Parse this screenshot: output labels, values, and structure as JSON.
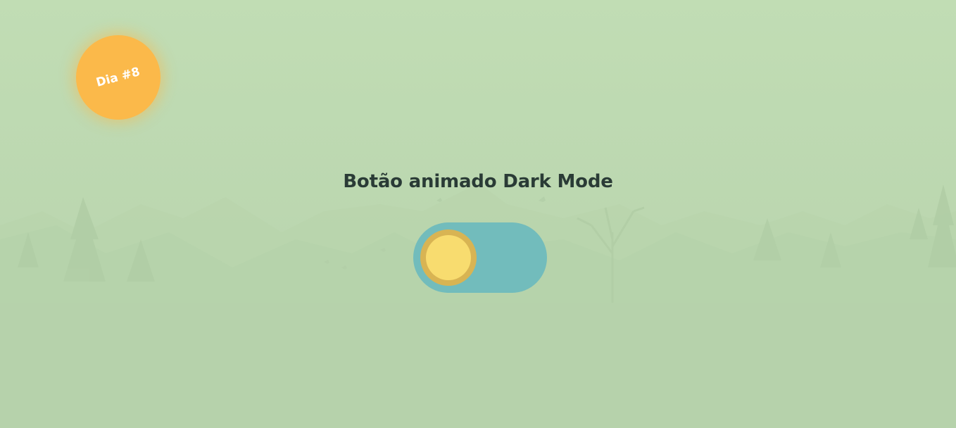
{
  "badge": {
    "label": "Dia #8",
    "color": "#fbb94a"
  },
  "header": {
    "title": "Botão animado Dark Mode"
  },
  "toggle": {
    "state": "light",
    "track_color": "#72bcbc",
    "knob_color": "#f8dc6f",
    "knob_ring_color": "#d8b453"
  },
  "colors": {
    "background": "#bfdcb2",
    "title_text": "#2a3b36"
  }
}
